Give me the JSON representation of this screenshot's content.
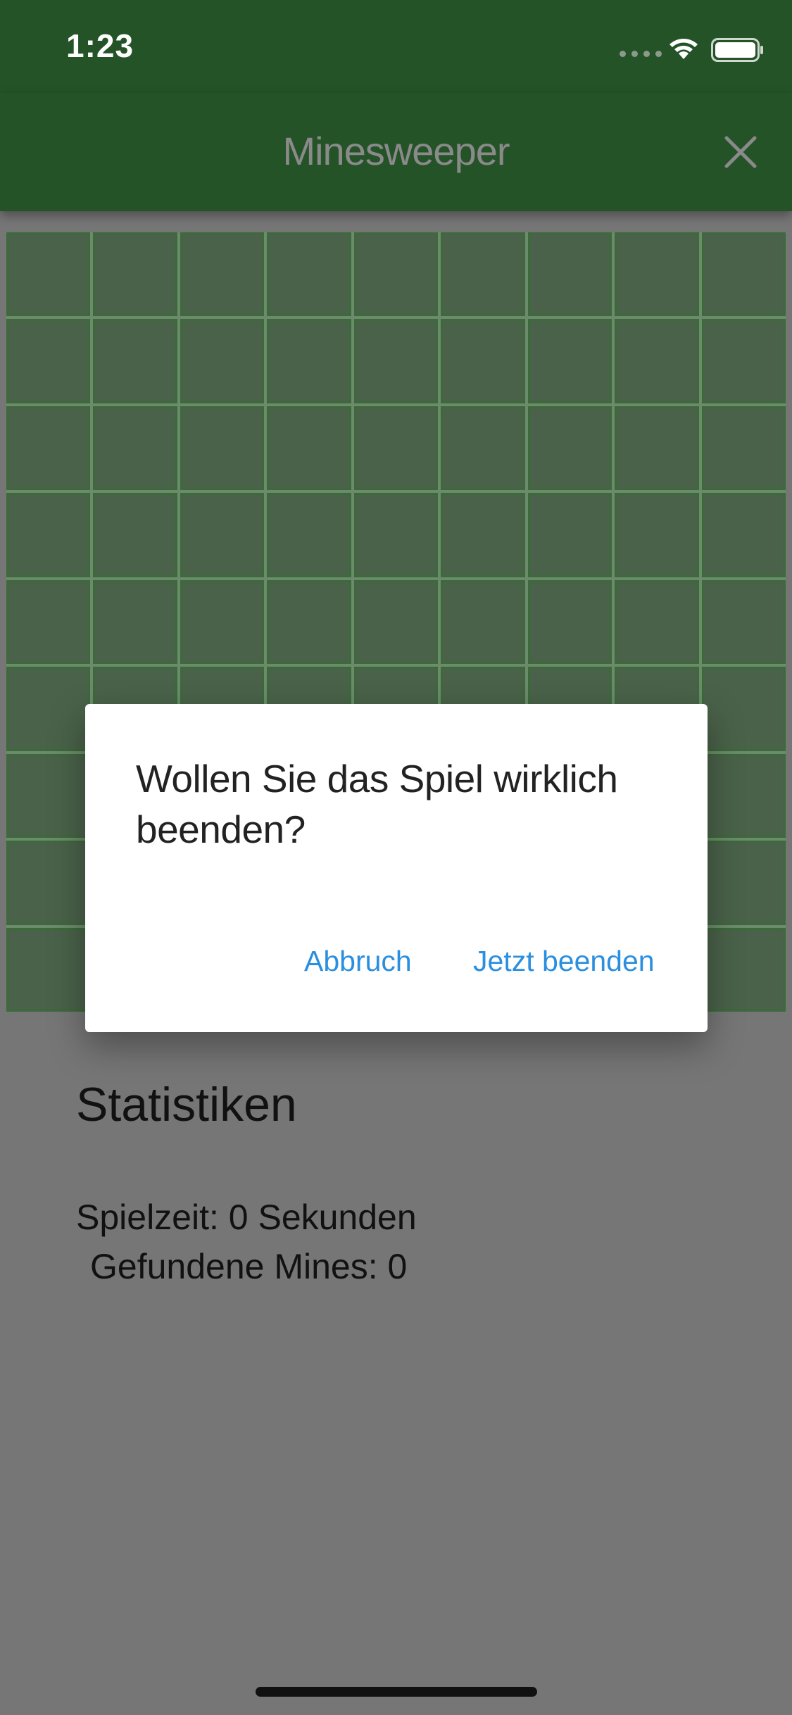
{
  "status_bar": {
    "time": "1:23"
  },
  "app_bar": {
    "title": "Minesweeper"
  },
  "board": {
    "rows": 9,
    "cols": 9,
    "cell_color": "#4a6249"
  },
  "statistics": {
    "title": "Statistiken",
    "play_time": "Spielzeit: 0 Sekunden",
    "mines_found": "Gefundene Mines: 0"
  },
  "dialog": {
    "message": "Wollen Sie das Spiel wirklich beenden?",
    "cancel_label": "Abbruch",
    "confirm_label": "Jetzt beenden"
  },
  "colors": {
    "app_bar": "#255328",
    "accent_button_text": "#2b8fe0",
    "overlay": "#767676"
  },
  "icons": [
    "wifi-icon",
    "battery-icon",
    "close-icon"
  ]
}
